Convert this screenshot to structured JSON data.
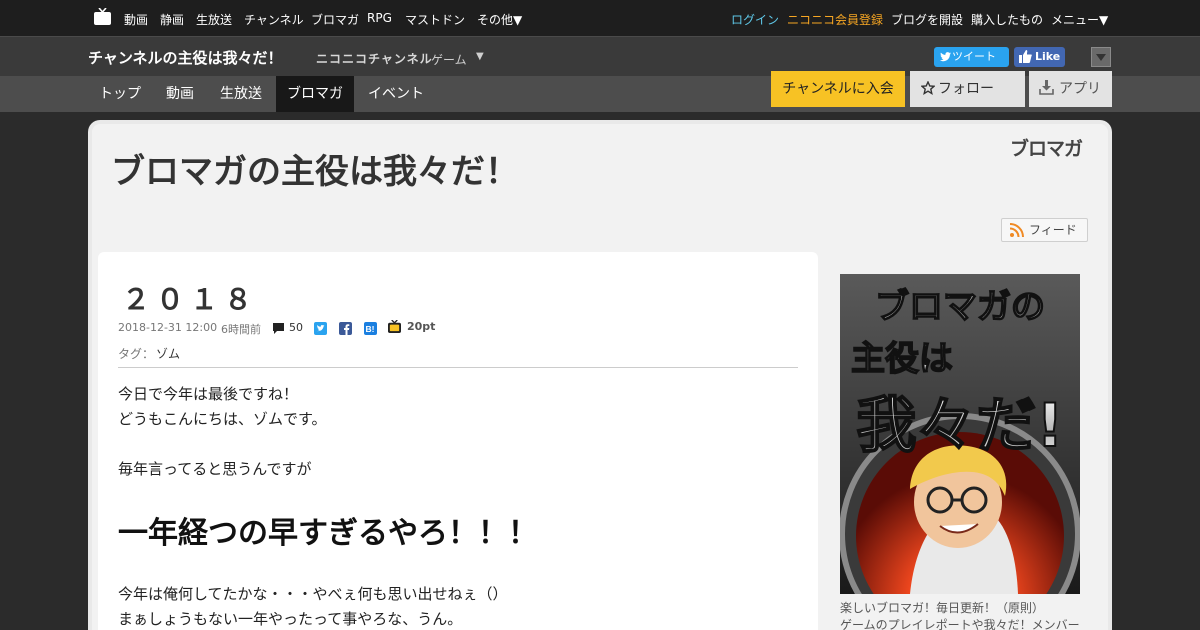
{
  "global_nav": {
    "items": [
      "動画",
      "静画",
      "生放送",
      "チャンネル",
      "ブロマガ",
      "RPG",
      "マストドン",
      "その他▼"
    ],
    "login": "ログイン",
    "register": "ニコニコ会員登録",
    "open_blog": "ブログを開設",
    "purchased": "購入したもの",
    "menu": "メニュー▼"
  },
  "channel": {
    "title": "チャンネルの主役は我々だ！",
    "brand": "ニコニコチャンネル",
    "category": "ゲーム",
    "tweet": "ツイート",
    "like": "Like"
  },
  "tabs": [
    "トップ",
    "動画",
    "生放送",
    "ブロマガ",
    "イベント"
  ],
  "active_tab": "ブロマガ",
  "actions": {
    "join": "チャンネルに入会",
    "follow": "フォロー",
    "app": "アプリ"
  },
  "blog": {
    "title": "ブロマガの主役は我々だ！",
    "logo": "ブロマガ",
    "feed": "フィード"
  },
  "article": {
    "title": "２０１８",
    "date": "2018-12-31 12:00",
    "ago": "6時間前",
    "comments": "50",
    "points": "20pt",
    "tag_label": "タグ：",
    "tag": "ゾム",
    "body": [
      "今日で今年は最後ですね！",
      "どうもこんにちは、ゾムです。",
      "毎年言ってると思うんですが",
      "一年経つの早すぎるやろ！！！",
      "今年は俺何してたかな・・・やべぇ何も思い出せねぇ（）",
      "まぁしょうもない一年やったって事やろな、うん。"
    ]
  },
  "sidebar": {
    "image_text": [
      "ブロマガの",
      "主役は",
      "我々だ!"
    ],
    "caption": [
      "楽しいブロマガ！毎日更新！（原則）",
      "ゲームのプレイレポートや我々だ！メンバー"
    ]
  },
  "colors": {
    "accent_yellow": "#f7c224",
    "link_cyan": "#5fc8e8",
    "link_orange": "#f6a623",
    "twitter": "#2aa3ef",
    "facebook": "#4267b2"
  }
}
